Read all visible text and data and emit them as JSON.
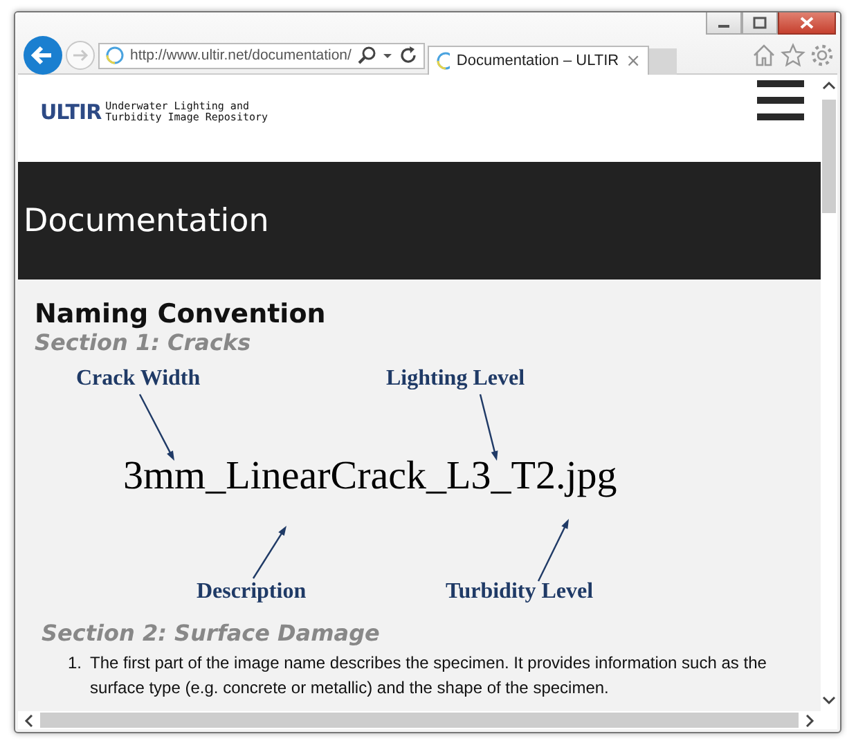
{
  "browser": {
    "address": "http://www.ultir.net/documentation/",
    "tab": {
      "title": "Documentation – ULTIR",
      "selected": true
    },
    "close_tab": "×"
  },
  "site": {
    "logo": "ULTIR",
    "tagline_1": "Underwater Lighting and",
    "tagline_2": "Turbidity Image Repository",
    "banner": "Documentation"
  },
  "content": {
    "heading": "Naming Convention",
    "section_1": "Section 1: Cracks",
    "diagram": {
      "filename": "3mm_LinearCrack_L3_T2.jpg",
      "labels": [
        {
          "text": "Crack Width"
        },
        {
          "text": "Lighting Level"
        },
        {
          "text": "Description"
        },
        {
          "text": "Turbidity Level"
        }
      ]
    },
    "section_2": "Section 2: Surface Damage",
    "list": [
      {
        "number": "1.",
        "text": "The first part of the image name describes the specimen. It provides information such as the surface type (e.g. concrete or metallic) and the shape of the specimen."
      }
    ]
  }
}
